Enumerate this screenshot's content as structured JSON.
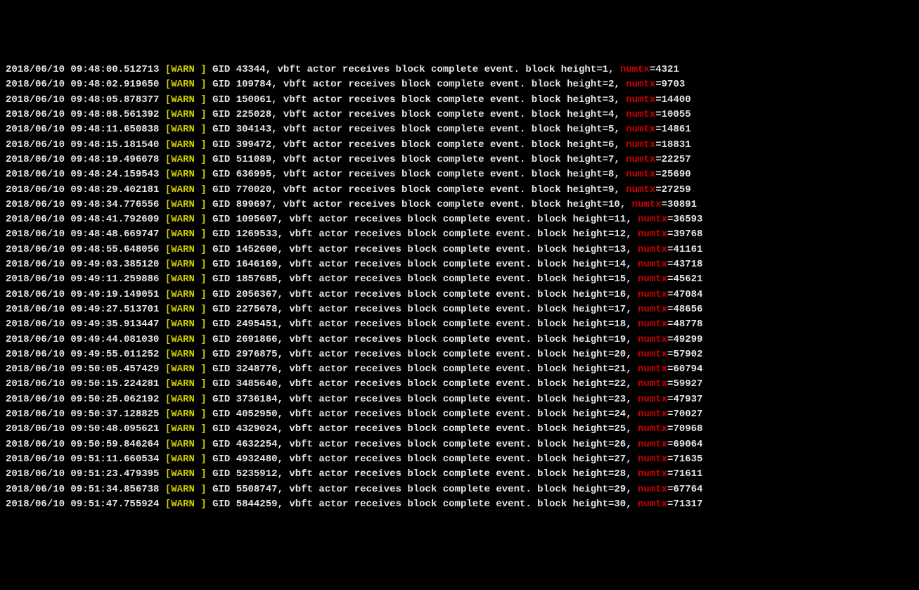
{
  "level_label": "[WARN ]",
  "msg_prefix": "GID",
  "msg_tail": "vbft actor receives block complete event. block height=",
  "numtx_key": "numtx",
  "lines": [
    {
      "ts": "2018/06/10 09:48:00.512713",
      "gid": "43344",
      "height": "1",
      "numtx": "4321"
    },
    {
      "ts": "2018/06/10 09:48:02.919650",
      "gid": "109784",
      "height": "2",
      "numtx": "9703"
    },
    {
      "ts": "2018/06/10 09:48:05.878377",
      "gid": "150061",
      "height": "3",
      "numtx": "14400"
    },
    {
      "ts": "2018/06/10 09:48:08.561392",
      "gid": "225028",
      "height": "4",
      "numtx": "10055"
    },
    {
      "ts": "2018/06/10 09:48:11.650838",
      "gid": "304143",
      "height": "5",
      "numtx": "14861"
    },
    {
      "ts": "2018/06/10 09:48:15.181540",
      "gid": "399472",
      "height": "6",
      "numtx": "18831"
    },
    {
      "ts": "2018/06/10 09:48:19.496678",
      "gid": "511089",
      "height": "7",
      "numtx": "22257"
    },
    {
      "ts": "2018/06/10 09:48:24.159543",
      "gid": "636995",
      "height": "8",
      "numtx": "25690"
    },
    {
      "ts": "2018/06/10 09:48:29.402181",
      "gid": "770020",
      "height": "9",
      "numtx": "27259"
    },
    {
      "ts": "2018/06/10 09:48:34.776556",
      "gid": "899697",
      "height": "10",
      "numtx": "30891"
    },
    {
      "ts": "2018/06/10 09:48:41.792609",
      "gid": "1095607",
      "height": "11",
      "numtx": "36593"
    },
    {
      "ts": "2018/06/10 09:48:48.669747",
      "gid": "1269533",
      "height": "12",
      "numtx": "39768"
    },
    {
      "ts": "2018/06/10 09:48:55.648056",
      "gid": "1452600",
      "height": "13",
      "numtx": "41161"
    },
    {
      "ts": "2018/06/10 09:49:03.385120",
      "gid": "1646169",
      "height": "14",
      "numtx": "43718"
    },
    {
      "ts": "2018/06/10 09:49:11.259886",
      "gid": "1857685",
      "height": "15",
      "numtx": "45621"
    },
    {
      "ts": "2018/06/10 09:49:19.149051",
      "gid": "2056367",
      "height": "16",
      "numtx": "47084"
    },
    {
      "ts": "2018/06/10 09:49:27.513701",
      "gid": "2275678",
      "height": "17",
      "numtx": "48656"
    },
    {
      "ts": "2018/06/10 09:49:35.913447",
      "gid": "2495451",
      "height": "18",
      "numtx": "48778"
    },
    {
      "ts": "2018/06/10 09:49:44.081030",
      "gid": "2691866",
      "height": "19",
      "numtx": "49299"
    },
    {
      "ts": "2018/06/10 09:49:55.011252",
      "gid": "2976875",
      "height": "20",
      "numtx": "57902"
    },
    {
      "ts": "2018/06/10 09:50:05.457429",
      "gid": "3248776",
      "height": "21",
      "numtx": "60794"
    },
    {
      "ts": "2018/06/10 09:50:15.224281",
      "gid": "3485640",
      "height": "22",
      "numtx": "59927"
    },
    {
      "ts": "2018/06/10 09:50:25.062192",
      "gid": "3736184",
      "height": "23",
      "numtx": "47937"
    },
    {
      "ts": "2018/06/10 09:50:37.128825",
      "gid": "4052950",
      "height": "24",
      "numtx": "70027"
    },
    {
      "ts": "2018/06/10 09:50:48.095621",
      "gid": "4329024",
      "height": "25",
      "numtx": "70968"
    },
    {
      "ts": "2018/06/10 09:50:59.846264",
      "gid": "4632254",
      "height": "26",
      "numtx": "69064"
    },
    {
      "ts": "2018/06/10 09:51:11.660534",
      "gid": "4932480",
      "height": "27",
      "numtx": "71635"
    },
    {
      "ts": "2018/06/10 09:51:23.479395",
      "gid": "5235912",
      "height": "28",
      "numtx": "71611"
    },
    {
      "ts": "2018/06/10 09:51:34.856738",
      "gid": "5508747",
      "height": "29",
      "numtx": "67764"
    },
    {
      "ts": "2018/06/10 09:51:47.755924",
      "gid": "5844259",
      "height": "30",
      "numtx": "71317"
    }
  ]
}
